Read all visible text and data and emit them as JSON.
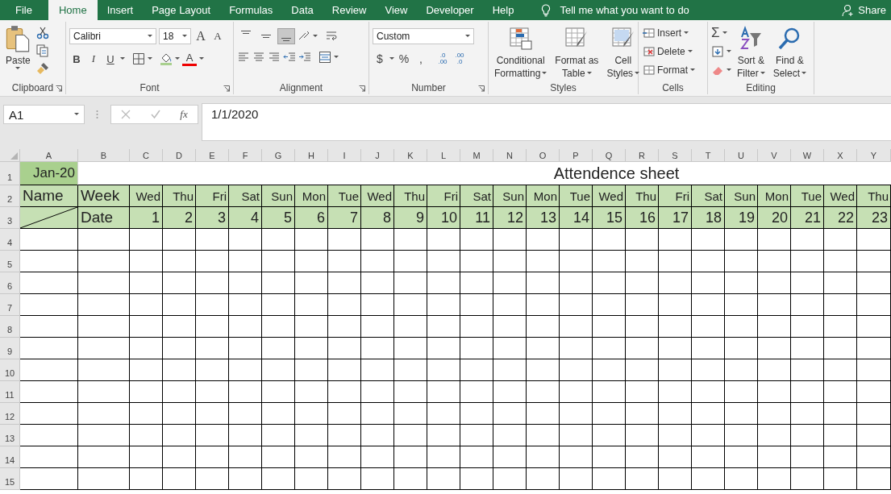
{
  "tabs": [
    {
      "label": "File",
      "selected": false
    },
    {
      "label": "Home",
      "selected": true
    },
    {
      "label": "Insert",
      "selected": false
    },
    {
      "label": "Page Layout",
      "selected": false
    },
    {
      "label": "Formulas",
      "selected": false
    },
    {
      "label": "Data",
      "selected": false
    },
    {
      "label": "Review",
      "selected": false
    },
    {
      "label": "View",
      "selected": false
    },
    {
      "label": "Developer",
      "selected": false
    },
    {
      "label": "Help",
      "selected": false
    }
  ],
  "tell_me": "Tell me what you want to do",
  "share": "Share",
  "clipboard": {
    "paste": "Paste",
    "label": "Clipboard"
  },
  "font": {
    "name": "Calibri",
    "size": "18",
    "grow": "A",
    "shrink": "A",
    "bold": "B",
    "italic": "I",
    "underline": "U",
    "font_color": "A",
    "label": "Font"
  },
  "alignment": {
    "vertical": [
      {
        "selected": false
      },
      {
        "selected": false
      },
      {
        "selected": true
      }
    ],
    "label": "Alignment"
  },
  "number": {
    "format": "Custom",
    "currency": "$",
    "percent": "%",
    "comma": ",",
    "increase_decimal": [
      ".0",
      ".00"
    ],
    "decrease_decimal": [
      ".00",
      ".0"
    ],
    "label": "Number"
  },
  "styles": {
    "buttons": [
      [
        "Conditional",
        "Formatting"
      ],
      [
        "Format as",
        "Table"
      ],
      [
        "Cell",
        "Styles"
      ]
    ],
    "label": "Styles"
  },
  "cells": {
    "buttons": [
      "Insert",
      "Delete",
      "Format"
    ],
    "label": "Cells"
  },
  "editing": {
    "sum": "Σ",
    "buttons": [
      [
        "Sort &",
        "Filter"
      ],
      [
        "Find &",
        "Select"
      ]
    ],
    "label": "Editing"
  },
  "formula_bar": {
    "name_box": "A1",
    "fx": "fx",
    "value": "1/1/2020"
  },
  "sheet": {
    "columns": [
      "A",
      "B",
      "C",
      "D",
      "E",
      "F",
      "G",
      "H",
      "I",
      "J",
      "K",
      "L",
      "M",
      "N",
      "O",
      "P",
      "Q",
      "R",
      "S",
      "T",
      "U",
      "V",
      "W",
      "X",
      "Y"
    ],
    "rows": [
      "1",
      "2",
      "3",
      "4",
      "5",
      "6",
      "7",
      "8",
      "9",
      "10",
      "11",
      "12",
      "13",
      "14",
      "15"
    ],
    "a1": "Jan-20",
    "title": "Attendence sheet",
    "name_header": "Name",
    "week_header": "Week",
    "date_header": "Date",
    "days": [
      {
        "weekday": "Wed",
        "date": "1"
      },
      {
        "weekday": "Thu",
        "date": "2"
      },
      {
        "weekday": "Fri",
        "date": "3"
      },
      {
        "weekday": "Sat",
        "date": "4"
      },
      {
        "weekday": "Sun",
        "date": "5"
      },
      {
        "weekday": "Mon",
        "date": "6"
      },
      {
        "weekday": "Tue",
        "date": "7"
      },
      {
        "weekday": "Wed",
        "date": "8"
      },
      {
        "weekday": "Thu",
        "date": "9"
      },
      {
        "weekday": "Fri",
        "date": "10"
      },
      {
        "weekday": "Sat",
        "date": "11"
      },
      {
        "weekday": "Sun",
        "date": "12"
      },
      {
        "weekday": "Mon",
        "date": "13"
      },
      {
        "weekday": "Tue",
        "date": "14"
      },
      {
        "weekday": "Wed",
        "date": "15"
      },
      {
        "weekday": "Thu",
        "date": "16"
      },
      {
        "weekday": "Fri",
        "date": "17"
      },
      {
        "weekday": "Sat",
        "date": "18"
      },
      {
        "weekday": "Sun",
        "date": "19"
      },
      {
        "weekday": "Mon",
        "date": "20"
      },
      {
        "weekday": "Tue",
        "date": "21"
      },
      {
        "weekday": "Wed",
        "date": "22"
      },
      {
        "weekday": "Thu",
        "date": "23"
      }
    ]
  }
}
